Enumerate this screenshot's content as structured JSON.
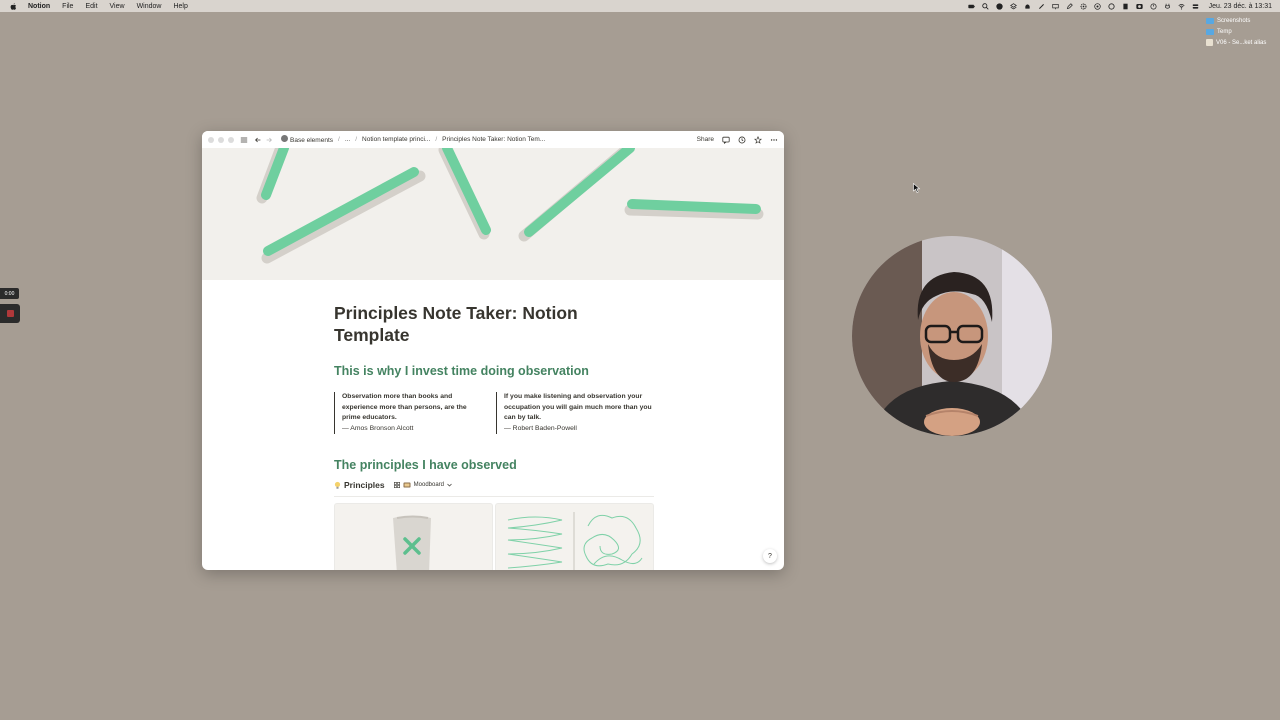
{
  "menubar": {
    "app_name": "Notion",
    "menus": [
      "File",
      "Edit",
      "View",
      "Window",
      "Help"
    ],
    "clock": "Jeu. 23 déc. à 13:31"
  },
  "desktop": {
    "items": [
      {
        "label": "Screenshots",
        "kind": "folder"
      },
      {
        "label": "Temp",
        "kind": "folder"
      },
      {
        "label": "V06 - Se...ket alias",
        "kind": "file"
      }
    ]
  },
  "recorder": {
    "time": "0:00"
  },
  "window": {
    "breadcrumbs": [
      "Base elements",
      "...",
      "Notion template princi...",
      "Principles Note Taker: Notion Tem..."
    ],
    "share_label": "Share",
    "help_label": "?"
  },
  "page": {
    "title": "Principles Note Taker: Notion Template",
    "heading1": "This is why I invest time doing observation",
    "quotes": [
      {
        "text": "Observation more than books and experience more than persons, are the prime educators.",
        "author": "— Amos Bronson Alcott"
      },
      {
        "text": "If you make listening and observation your occupation you will gain much more than you can by talk.",
        "author": "— Robert Baden-Powell"
      }
    ],
    "heading2": "The principles I have observed",
    "database": {
      "title": "Principles",
      "view_label": "Moodboard"
    }
  },
  "colors": {
    "accent_green": "#448361",
    "cover_stroke": "#6fcf9f",
    "desktop_bg": "#a69d93"
  }
}
